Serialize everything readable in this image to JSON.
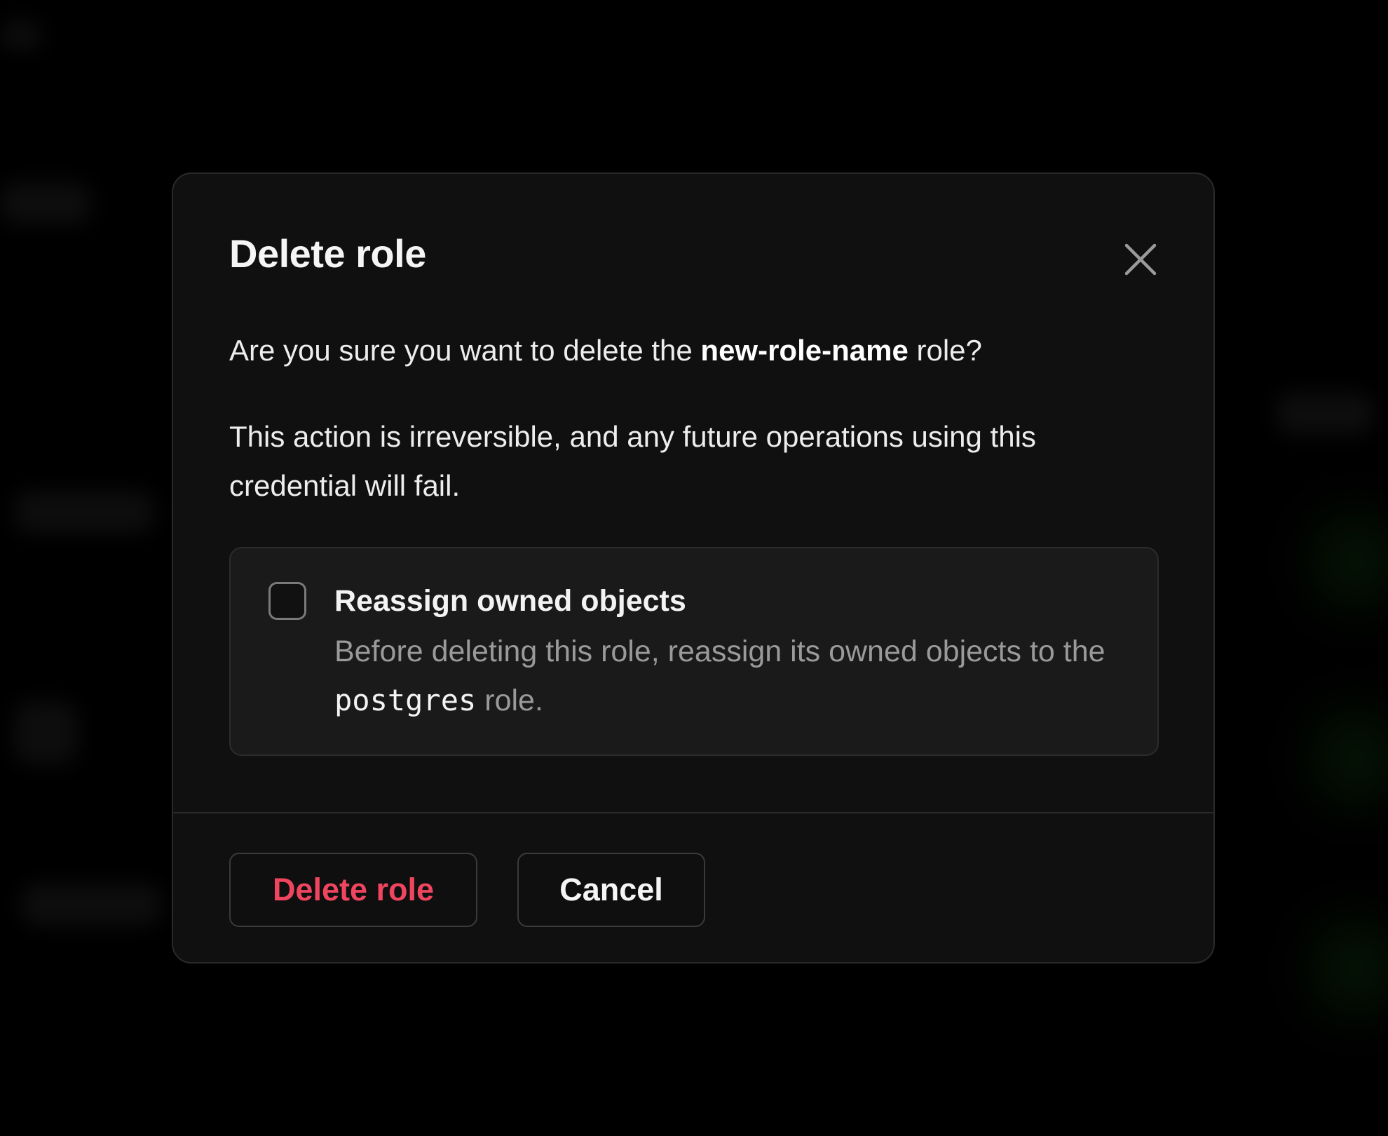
{
  "modal": {
    "title": "Delete role",
    "close_label": "Close",
    "confirm_prefix": "Are you sure you want to delete the ",
    "role_name": "new-role-name",
    "confirm_suffix": " role?",
    "warning": "This action is irreversible, and any future operations using this credential will fail.",
    "option": {
      "title": "Reassign owned objects",
      "desc_prefix": "Before deleting this role, reassign its owned objects to the ",
      "target_role": "postgres",
      "desc_suffix": " role.",
      "checked": false
    },
    "buttons": {
      "delete_label": "Delete role",
      "cancel_label": "Cancel"
    }
  },
  "colors": {
    "danger": "#f0455f",
    "surface": "#101010",
    "card": "#1a1a1a"
  },
  "icons": {
    "close": "close-icon"
  }
}
